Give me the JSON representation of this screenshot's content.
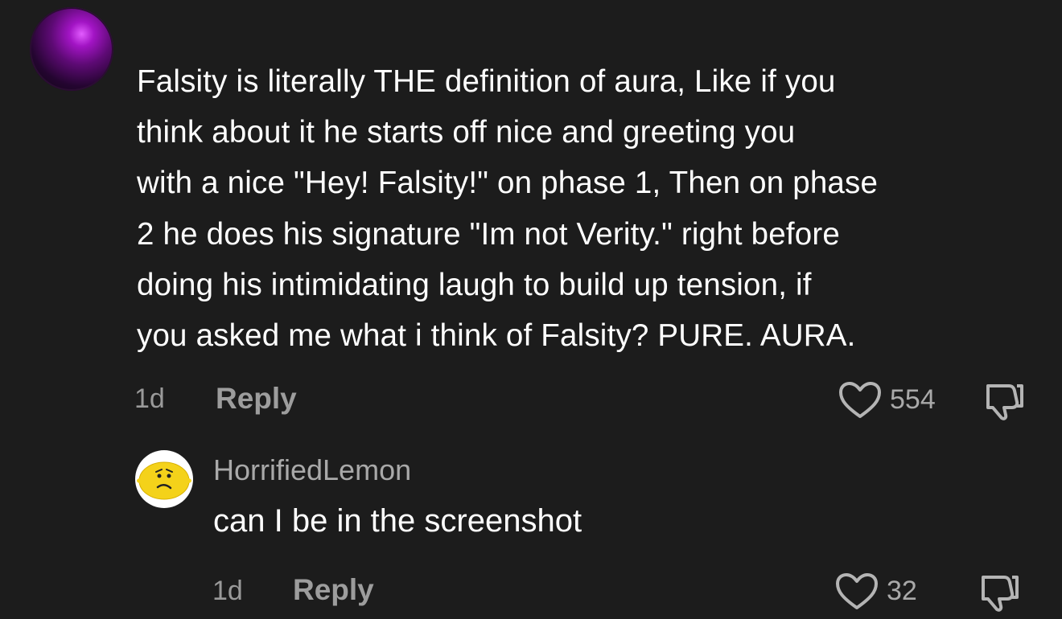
{
  "comment": {
    "text": "Falsity is literally THE definition of aura, Like if you\nthink about it he starts off nice and greeting you\nwith a nice \"Hey! Falsity!\" on phase 1, Then on phase\n2 he does his signature \"Im not Verity.\" right before\ndoing his intimidating laugh to build up tension, if\nyou asked me what i think of Falsity? PURE. AURA.",
    "age": "1d",
    "reply_label": "Reply",
    "likes": "554"
  },
  "reply": {
    "username": "HorrifiedLemon",
    "text": "can I be in the screenshot",
    "age": "1d",
    "reply_label": "Reply",
    "likes": "32"
  },
  "icons": {
    "like": "heart-outline-icon",
    "dislike": "thumbs-down-icon"
  },
  "colors": {
    "background": "#1c1c1c",
    "text": "#ffffff",
    "muted": "#9a9a9a"
  }
}
